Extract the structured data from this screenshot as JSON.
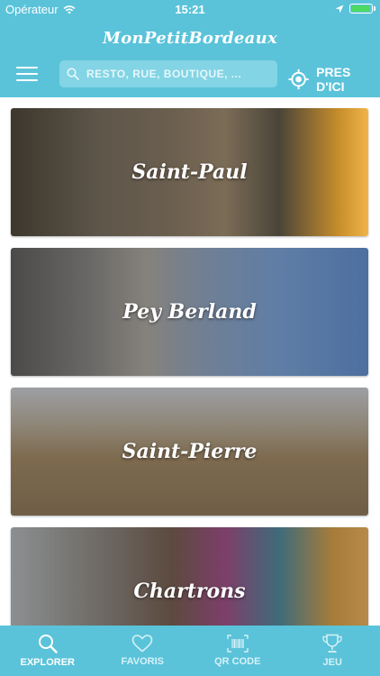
{
  "status": {
    "carrier": "Opérateur",
    "time": "15:21"
  },
  "header": {
    "title": "MonPetitBordeaux",
    "search_placeholder": "RESTO, RUE, BOUTIQUE, ...",
    "nearby_label": "PRES D'ICI"
  },
  "neighborhoods": [
    {
      "name": "Saint-Paul"
    },
    {
      "name": "Pey Berland"
    },
    {
      "name": "Saint-Pierre"
    },
    {
      "name": "Chartrons"
    }
  ],
  "tabs": [
    {
      "label": "EXPLORER",
      "icon": "search-icon",
      "active": true
    },
    {
      "label": "FAVORIS",
      "icon": "heart-icon",
      "active": false
    },
    {
      "label": "QR CODE",
      "icon": "qr-code-icon",
      "active": false
    },
    {
      "label": "JEU",
      "icon": "trophy-icon",
      "active": false
    }
  ],
  "colors": {
    "brand": "#5ac3d9",
    "search_bg": "#83d4e4",
    "battery": "#4cd964"
  }
}
